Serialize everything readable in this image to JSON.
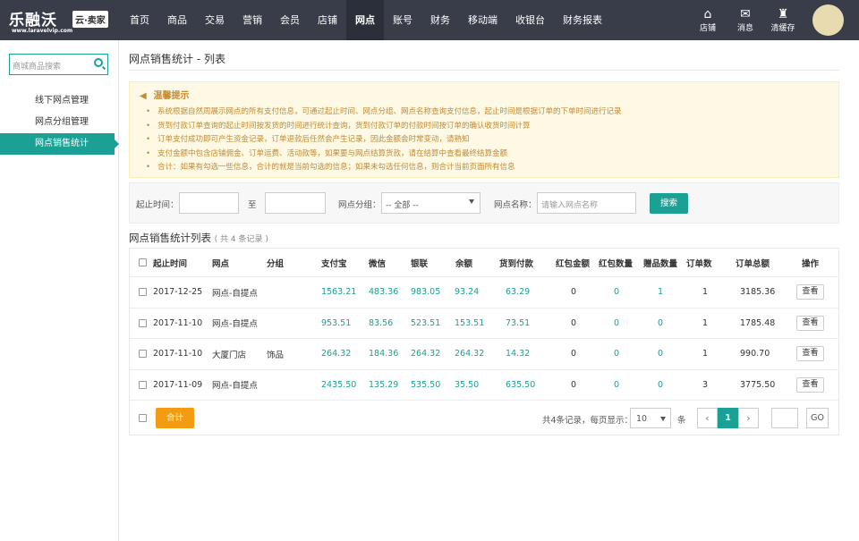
{
  "logo": {
    "main": "乐融沃",
    "badge": "云·卖家",
    "sub": "www.laravelvip.com"
  },
  "nav": [
    "首页",
    "商品",
    "交易",
    "营销",
    "会员",
    "店铺",
    "网点",
    "账号",
    "财务",
    "移动端",
    "收银台",
    "财务报表"
  ],
  "top_icons": [
    {
      "icon": "home-icon",
      "glyph": "⌂",
      "label": "店铺"
    },
    {
      "icon": "bird-icon",
      "glyph": "✉",
      "label": "消息"
    },
    {
      "icon": "broom-icon",
      "glyph": "♜",
      "label": "清缓存"
    }
  ],
  "sidebar": {
    "search_placeholder": "商城商品搜索",
    "items": [
      "线下网点管理",
      "网点分组管理",
      "网点销售统计"
    ]
  },
  "page": {
    "title": "网点销售统计 - 列表"
  },
  "tips": {
    "title": "温馨提示",
    "items": [
      "系统根据自然周展示网点的所有支付信息，可通过起止时间、网点分组、网点名称查询支付信息，起止时间是根据订单的下单时间进行记录",
      "货到付款订单查询的起止时间按发货的时间进行统计查询，货到付款订单的付款时间按订单的确认收货时间计算",
      "订单支付成功即可产生资金记录，订单退款后任然会产生记录，因此金额会时常变动，请熟知",
      "支付金额中包含店铺佣金、订单运费、活动款等，如果要与网点结算货款，请在结算中查看最终结算金额",
      "合计：如果有勾选一些信息，合计的就是当前勾选的信息；如果未勾选任何信息，则合计当前页面所有信息"
    ]
  },
  "filter": {
    "start_label": "起止时间：",
    "to_label": "至",
    "group_label": "网点分组：",
    "group_value": "-- 全部 --",
    "name_label": "网点名称：",
    "name_placeholder": "请输入网点名称",
    "search_button": "搜索"
  },
  "list": {
    "title": "网点销售统计列表",
    "count": "( 共 4 条记录 )"
  },
  "table": {
    "headers": [
      "起止时间",
      "网点",
      "分组",
      "支付宝",
      "微信",
      "银联",
      "余额",
      "货到付款",
      "红包金额",
      "红包数量",
      "赠品数量",
      "订单数",
      "订单总额",
      "操作"
    ],
    "rows": [
      [
        "2017-12-25",
        "网点-自提点",
        "",
        "1563.21",
        "483.36",
        "983.05",
        "93.24",
        "63.29",
        "0",
        "0",
        "1",
        "1",
        "3185.36",
        "查看"
      ],
      [
        "2017-11-10",
        "网点-自提点",
        "",
        "953.51",
        "83.56",
        "523.51",
        "153.51",
        "73.51",
        "0",
        "0",
        "0",
        "1",
        "1785.48",
        "查看"
      ],
      [
        "2017-11-10",
        "大厦门店",
        "饰品",
        "264.32",
        "184.36",
        "264.32",
        "264.32",
        "14.32",
        "0",
        "0",
        "0",
        "1",
        "990.70",
        "查看"
      ],
      [
        "2017-11-09",
        "网点-自提点",
        "",
        "2435.50",
        "135.29",
        "535.50",
        "35.50",
        "635.50",
        "0",
        "0",
        "0",
        "3",
        "3775.50",
        "查看"
      ]
    ]
  },
  "footer": {
    "total_button": "合计",
    "summary": "共4条记录，每页显示：",
    "page_size": "10",
    "unit": "条",
    "prev": "‹",
    "current_page": "1",
    "next": "›",
    "go": "GO"
  },
  "colors": {
    "accent": "#1aa094",
    "topbar": "#393d49",
    "tips_text": "#c48a34",
    "total_button": "#f39c12"
  }
}
